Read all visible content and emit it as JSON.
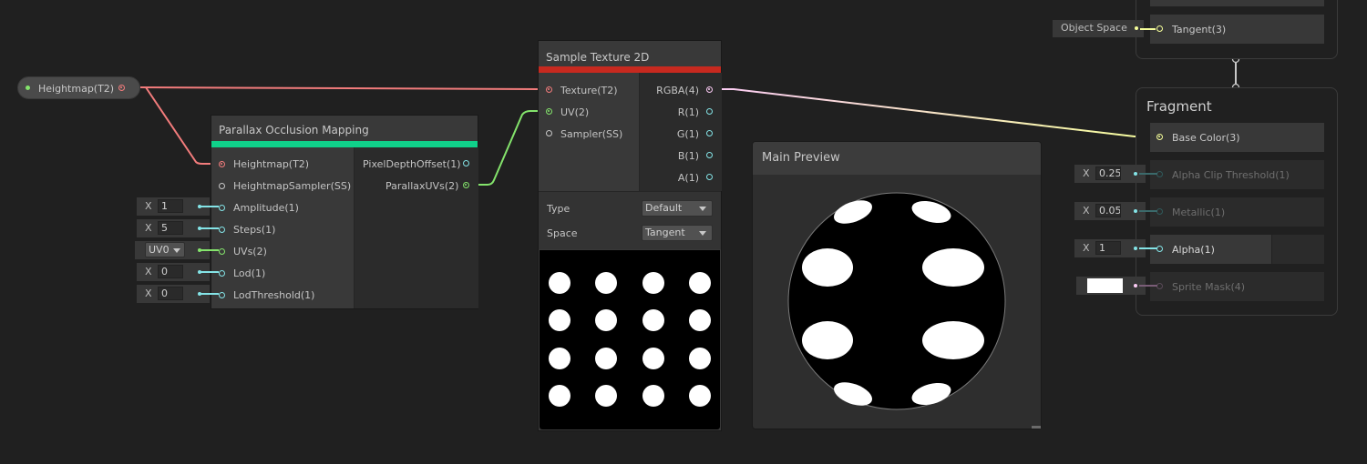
{
  "colors": {
    "texture": "#f27c7c",
    "vector2": "#84e46c",
    "vector1": "#84e4e7",
    "vector3": "#f6ff9a",
    "vector4": "#fbcbf4",
    "sampler": "#c8c8c8",
    "pom_accent": "#10d18a",
    "sample_accent": "#c7291f"
  },
  "property": {
    "label": "Heightmap(T2)"
  },
  "pom": {
    "title": "Parallax Occlusion Mapping",
    "inputs": [
      "Heightmap(T2)",
      "HeightmapSampler(SS)",
      "Amplitude(1)",
      "Steps(1)",
      "UVs(2)",
      "Lod(1)",
      "LodThreshold(1)"
    ],
    "outputs": [
      "PixelDepthOffset(1)",
      "ParallaxUVs(2)"
    ],
    "fields": {
      "amplitude": {
        "axis": "X",
        "value": "1"
      },
      "steps": {
        "axis": "X",
        "value": "5"
      },
      "uvs": {
        "value": "UV0"
      },
      "lod": {
        "axis": "X",
        "value": "0"
      },
      "lod_threshold": {
        "axis": "X",
        "value": "0"
      }
    }
  },
  "sample": {
    "title": "Sample Texture 2D",
    "inputs": [
      "Texture(T2)",
      "UV(2)",
      "Sampler(SS)"
    ],
    "outputs": [
      "RGBA(4)",
      "R(1)",
      "G(1)",
      "B(1)",
      "A(1)"
    ],
    "type_label": "Type",
    "type_value": "Default",
    "space_label": "Space",
    "space_value": "Tangent",
    "texture_grid": {
      "rows": 4,
      "cols": 4
    }
  },
  "preview": {
    "title": "Main Preview"
  },
  "vertex": {
    "tangent_label": "Tangent(3)",
    "tangent_field": "Object Space"
  },
  "fragment": {
    "title": "Fragment",
    "blocks": [
      {
        "label": "Base Color(3)",
        "active": true
      },
      {
        "label": "Alpha Clip Threshold(1)",
        "active": false,
        "axis": "X",
        "value": "0.25"
      },
      {
        "label": "Metallic(1)",
        "active": false,
        "axis": "X",
        "value": "0.05"
      },
      {
        "label": "Alpha(1)",
        "active": true,
        "axis": "X",
        "value": "1"
      },
      {
        "label": "Sprite Mask(4)",
        "active": false
      }
    ]
  }
}
